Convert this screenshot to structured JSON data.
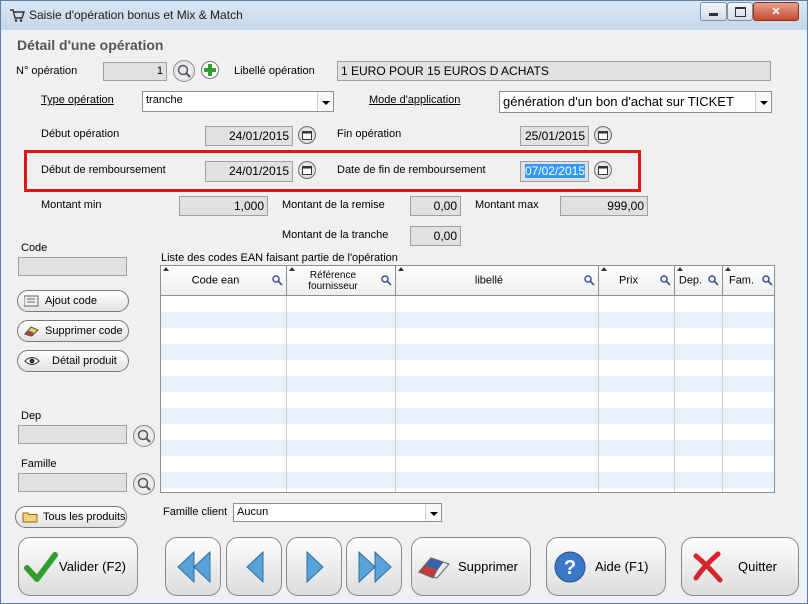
{
  "window": {
    "title": "Saisie d'opération bonus et Mix & Match"
  },
  "section_title": "Détail d'une opération",
  "no_operation": {
    "label": "N° opération",
    "value": "1"
  },
  "libelle": {
    "label": "Libellé opération",
    "value": "1 EURO POUR 15 EUROS D ACHATS"
  },
  "type_operation": {
    "label": "Type opération",
    "value": "tranche"
  },
  "mode_application": {
    "label": "Mode d'application",
    "value": "génération d'un bon d'achat sur TICKET"
  },
  "debut_operation": {
    "label": "Début opération",
    "value": "24/01/2015"
  },
  "fin_operation": {
    "label": "Fin opération",
    "value": "25/01/2015"
  },
  "debut_remboursement": {
    "label": "Début de remboursement",
    "value": "24/01/2015"
  },
  "fin_remboursement": {
    "label": "Date de fin de remboursement",
    "value": "07/02/2015"
  },
  "montant_min": {
    "label": "Montant min",
    "value": "1,000"
  },
  "montant_remise": {
    "label": "Montant de la remise",
    "value": "0,00"
  },
  "montant_max": {
    "label": "Montant max",
    "value": "999,00"
  },
  "montant_tranche": {
    "label": "Montant de la tranche",
    "value": "0,00"
  },
  "code": {
    "label": "Code",
    "value": ""
  },
  "dep": {
    "label": "Dep",
    "value": ""
  },
  "famille": {
    "label": "Famille",
    "value": ""
  },
  "left_buttons": {
    "ajout": "Ajout code",
    "supprimer": "Supprimer code",
    "detail": "Détail produit",
    "tous": "Tous les produits"
  },
  "grid": {
    "caption": "Liste des codes EAN faisant partie de l'opération",
    "columns": [
      "Code ean",
      "Référence fournisseur",
      "libellé",
      "Prix",
      "Dep.",
      "Fam."
    ]
  },
  "famille_client": {
    "label": "Famille client",
    "value": "Aucun"
  },
  "bottom_buttons": {
    "valider": "Valider (F2)",
    "supprimer": "Supprimer",
    "aide": "Aide (F1)",
    "quitter": "Quitter"
  },
  "colors": {
    "highlight_box": "#e2141b",
    "selection": "#3399ff"
  }
}
